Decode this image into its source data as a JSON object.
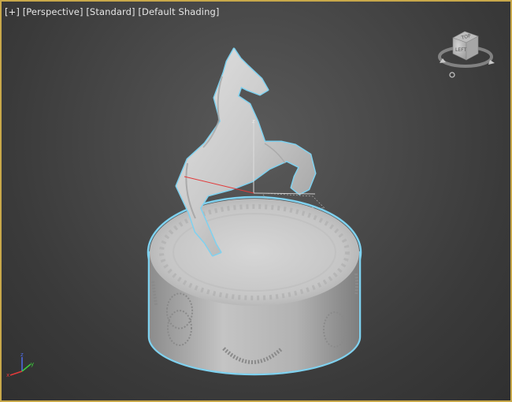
{
  "viewport": {
    "menu_plus": "[+]",
    "view_label": "[Perspective]",
    "style_label": "[Standard]",
    "shading_label": "[Default Shading]",
    "active_border_color": "#c8a84a",
    "selection_outline_color": "#7fd1ef"
  },
  "viewcube": {
    "face_label": "LEFT",
    "top_label": "TOP"
  },
  "gizmo": {
    "z_label": "z",
    "x_label": "x",
    "y_label": "y"
  },
  "world_axis": {
    "x_label": "x",
    "y_label": "y",
    "z_label": "z"
  }
}
